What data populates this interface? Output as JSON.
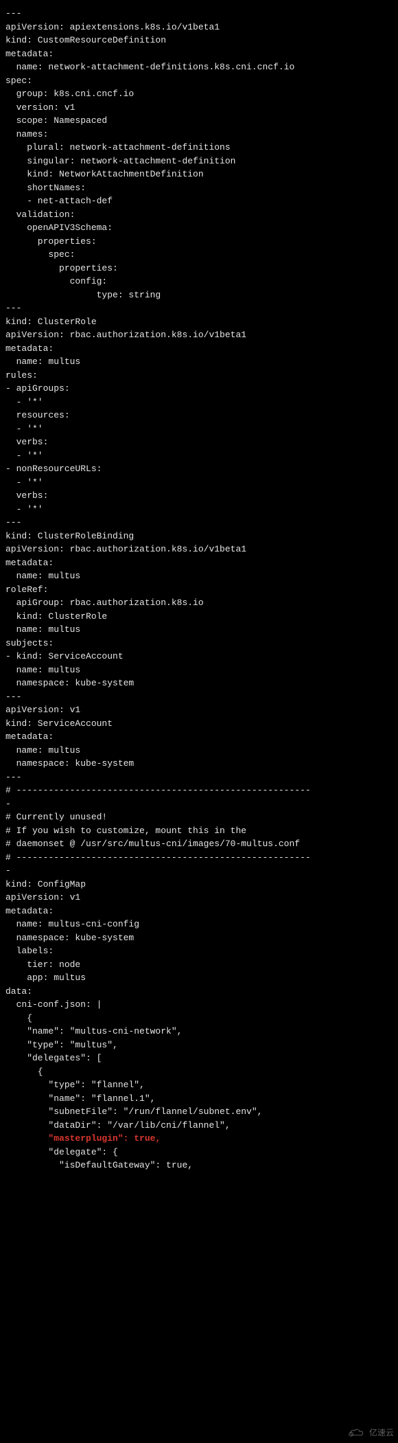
{
  "lines": [
    {
      "t": "---"
    },
    {
      "t": "apiVersion: apiextensions.k8s.io/v1beta1"
    },
    {
      "t": "kind: CustomResourceDefinition"
    },
    {
      "t": "metadata:"
    },
    {
      "t": "  name: network-attachment-definitions.k8s.cni.cncf.io"
    },
    {
      "t": "spec:"
    },
    {
      "t": "  group: k8s.cni.cncf.io"
    },
    {
      "t": "  version: v1"
    },
    {
      "t": "  scope: Namespaced"
    },
    {
      "t": "  names:"
    },
    {
      "t": "    plural: network-attachment-definitions"
    },
    {
      "t": "    singular: network-attachment-definition"
    },
    {
      "t": "    kind: NetworkAttachmentDefinition"
    },
    {
      "t": "    shortNames:"
    },
    {
      "t": "    - net-attach-def"
    },
    {
      "t": "  validation:"
    },
    {
      "t": "    openAPIV3Schema:"
    },
    {
      "t": "      properties:"
    },
    {
      "t": "        spec:"
    },
    {
      "t": "          properties:"
    },
    {
      "t": "            config:"
    },
    {
      "t": "                 type: string"
    },
    {
      "t": "---"
    },
    {
      "t": "kind: ClusterRole"
    },
    {
      "t": "apiVersion: rbac.authorization.k8s.io/v1beta1"
    },
    {
      "t": "metadata:"
    },
    {
      "t": "  name: multus"
    },
    {
      "t": "rules:"
    },
    {
      "t": "- apiGroups:"
    },
    {
      "t": "  - '*'"
    },
    {
      "t": "  resources:"
    },
    {
      "t": "  - '*'"
    },
    {
      "t": "  verbs:"
    },
    {
      "t": "  - '*'"
    },
    {
      "t": "- nonResourceURLs:"
    },
    {
      "t": "  - '*'"
    },
    {
      "t": "  verbs:"
    },
    {
      "t": "  - '*'"
    },
    {
      "t": "---"
    },
    {
      "t": "kind: ClusterRoleBinding"
    },
    {
      "t": "apiVersion: rbac.authorization.k8s.io/v1beta1"
    },
    {
      "t": "metadata:"
    },
    {
      "t": "  name: multus"
    },
    {
      "t": "roleRef:"
    },
    {
      "t": "  apiGroup: rbac.authorization.k8s.io"
    },
    {
      "t": "  kind: ClusterRole"
    },
    {
      "t": "  name: multus"
    },
    {
      "t": "subjects:"
    },
    {
      "t": "- kind: ServiceAccount"
    },
    {
      "t": "  name: multus"
    },
    {
      "t": "  namespace: kube-system"
    },
    {
      "t": "---"
    },
    {
      "t": "apiVersion: v1"
    },
    {
      "t": "kind: ServiceAccount"
    },
    {
      "t": "metadata:"
    },
    {
      "t": "  name: multus"
    },
    {
      "t": "  namespace: kube-system"
    },
    {
      "t": "---"
    },
    {
      "t": "# -------------------------------------------------------"
    },
    {
      "t": "-"
    },
    {
      "t": "# Currently unused!"
    },
    {
      "t": "# If you wish to customize, mount this in the"
    },
    {
      "t": "# daemonset @ /usr/src/multus-cni/images/70-multus.conf"
    },
    {
      "t": "# -------------------------------------------------------"
    },
    {
      "t": "-"
    },
    {
      "t": "kind: ConfigMap"
    },
    {
      "t": "apiVersion: v1"
    },
    {
      "t": "metadata:"
    },
    {
      "t": "  name: multus-cni-config"
    },
    {
      "t": "  namespace: kube-system"
    },
    {
      "t": "  labels:"
    },
    {
      "t": "    tier: node"
    },
    {
      "t": "    app: multus"
    },
    {
      "t": "data:"
    },
    {
      "t": "  cni-conf.json: |"
    },
    {
      "t": "    {"
    },
    {
      "t": "    \"name\": \"multus-cni-network\","
    },
    {
      "t": "    \"type\": \"multus\","
    },
    {
      "t": "    \"delegates\": ["
    },
    {
      "t": "      {"
    },
    {
      "t": "        \"type\": \"flannel\","
    },
    {
      "t": "        \"name\": \"flannel.1\","
    },
    {
      "t": "        \"subnetFile\": \"/run/flannel/subnet.env\","
    },
    {
      "t": "        \"dataDir\": \"/var/lib/cni/flannel\","
    },
    {
      "t": "        \"masterplugin\": true,",
      "red": true,
      "indent": "        "
    },
    {
      "t": "        \"delegate\": {"
    },
    {
      "t": "          \"isDefaultGateway\": true,"
    }
  ],
  "watermark": "亿速云"
}
